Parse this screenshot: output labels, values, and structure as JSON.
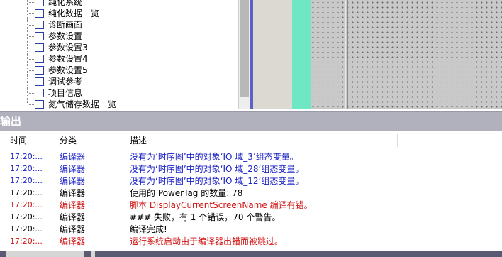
{
  "tree": {
    "items": [
      {
        "label": "纯化系统"
      },
      {
        "label": "纯化数据一览"
      },
      {
        "label": "诊断画面"
      },
      {
        "label": "参数设置"
      },
      {
        "label": "参数设置3"
      },
      {
        "label": "参数设置4"
      },
      {
        "label": "参数设置5"
      },
      {
        "label": "调试参考"
      },
      {
        "label": "项目信息"
      },
      {
        "label": "氮气储存数据一览"
      }
    ]
  },
  "output": {
    "title": "输出",
    "columns": {
      "time": "时间",
      "category": "分类",
      "description": "描述"
    },
    "rows": [
      {
        "time": "17:20:...",
        "category": "编译器",
        "description": "没有为‘时序图’中的对象‘IO 域_3’组态变量。",
        "level": "info"
      },
      {
        "time": "17:20:...",
        "category": "编译器",
        "description": "没有为‘时序图’中的对象‘IO 域_28’组态变量。",
        "level": "info"
      },
      {
        "time": "17:20:...",
        "category": "编译器",
        "description": "没有为‘时序图’中的对象‘IO 域_12’组态变量。",
        "level": "info"
      },
      {
        "time": "17:20:...",
        "category": "编译器",
        "description": "使用的 PowerTag 的数量: 78",
        "level": "plain"
      },
      {
        "time": "17:20:...",
        "category": "编译器",
        "description": "脚本 DisplayCurrentScreenName 编译有错。",
        "level": "error"
      },
      {
        "time": "17:20:...",
        "category": "编译器",
        "description": "### 失败，有 1 个错误，70 个警告。",
        "level": "plain"
      },
      {
        "time": "17:20:...",
        "category": "编译器",
        "description": "编译完成!",
        "level": "plain"
      },
      {
        "time": "17:20:...",
        "category": "编译器",
        "description": "运行系统启动由于编译器出错而被跳过。",
        "level": "error"
      }
    ]
  },
  "colors": {
    "info": "#1c23c6",
    "error": "#d01515",
    "plain": "#000000",
    "panel_title_bg": "#b1b0bd",
    "teal": "#6ee8c4",
    "divider": "#5b62c4"
  },
  "icons": {
    "tree_item": "screen-page-icon"
  }
}
